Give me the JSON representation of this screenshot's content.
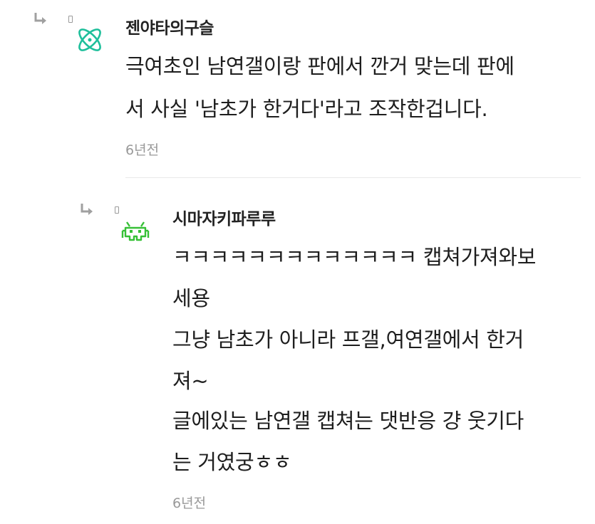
{
  "comments": [
    {
      "nickname": "젠야타의구슬",
      "avatar_icon": "orbit-atom-icon",
      "avatar_color": "#1fbf9b",
      "lines": [
        "극여초인 남연갤이랑 판에서 깐거 맞는데 판에",
        "서 사실 '남초가 한거다'라고 조작한겁니다."
      ],
      "time": "6년전"
    },
    {
      "nickname": "시마자키파루루",
      "avatar_icon": "space-invader-icon",
      "avatar_color": "#36c036",
      "lines": [
        "ㅋㅋㅋㅋㅋㅋㅋㅋㅋㅋㅋㅋㅋ 캡쳐가져와보",
        "세용",
        "그냥 남초가 아니라 프갤,여연갤에서 한거",
        "져~",
        "글에있는 남연갤 캡쳐는 댓반응 걍 웃기다",
        "는 거였궁ㅎㅎ"
      ],
      "time": "6년전"
    }
  ],
  "colors": {
    "reply_arrow": "#a0a0a0",
    "time_text": "#999999",
    "divider": "#e9e9e9"
  }
}
